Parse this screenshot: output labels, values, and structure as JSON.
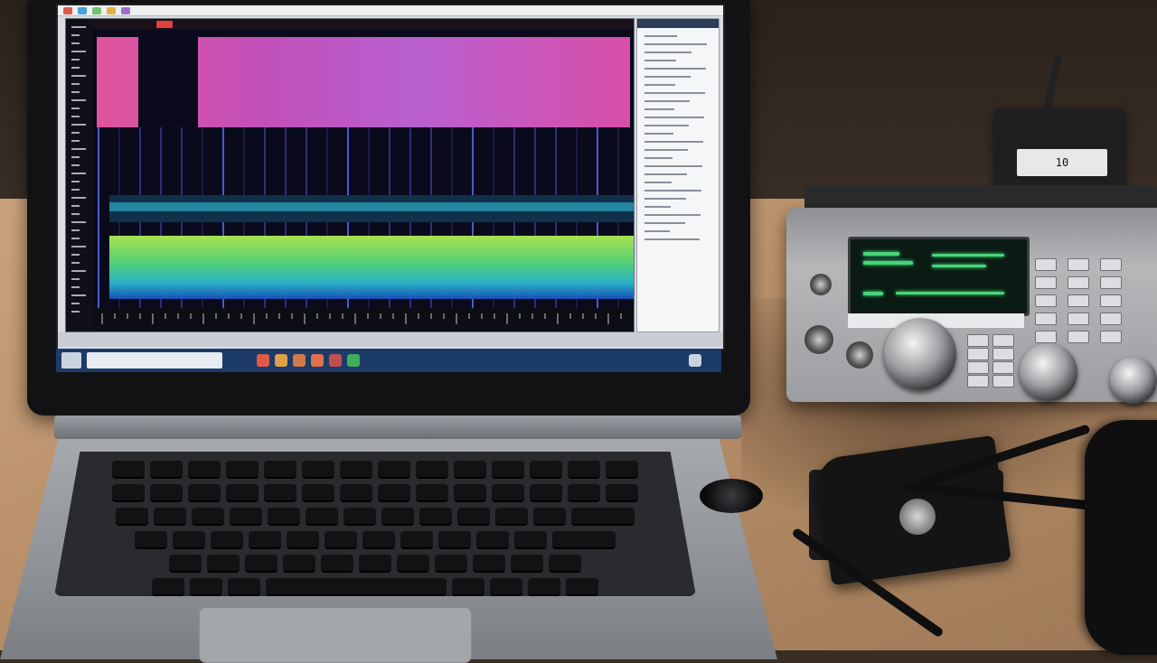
{
  "scene": {
    "description_tags": [
      "laptop",
      "sdr-waterfall-software",
      "ham-radio-transceiver",
      "microphone",
      "headphones",
      "desk"
    ]
  },
  "laptop": {
    "brand": "",
    "taskbar_field": "",
    "sdr_app": {
      "waterfall_bands": [
        {
          "name": "magenta-band",
          "color": "#d04fb5"
        },
        {
          "name": "cyan-band",
          "color": "#3fb7c9"
        },
        {
          "name": "green-band",
          "color": "#7ed957"
        },
        {
          "name": "blue-band",
          "color": "#1f6fd1"
        }
      ]
    }
  },
  "radio": {
    "display_color": "#4bd37a",
    "speaker_readout": "10"
  },
  "colors": {
    "desk": "#c29c76",
    "laptop_body": "#9da0a4",
    "taskbar": "#1c3b66"
  }
}
